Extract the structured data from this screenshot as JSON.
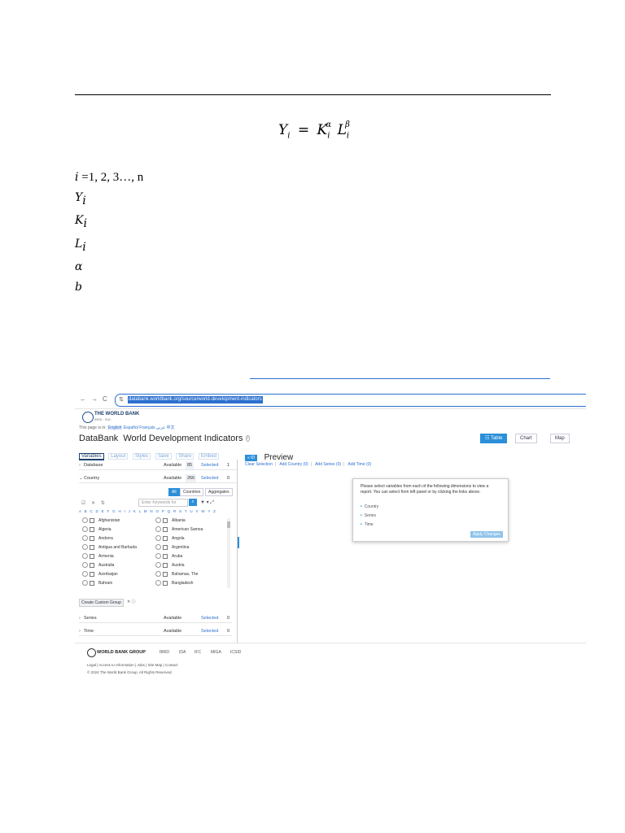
{
  "document": {
    "formula": {
      "Y": "Y",
      "K": "K",
      "L": "L",
      "sub": "i",
      "eq": "=",
      "alpha": "α",
      "beta": "β"
    },
    "index_line": {
      "var": "i",
      "text": " =1, 2, 3…, n"
    },
    "variables": [
      {
        "sym": "Y",
        "sub": "i"
      },
      {
        "sym": "K",
        "sub": "i"
      },
      {
        "sym": "L",
        "sub": "i"
      },
      {
        "sym": "α",
        "sub": ""
      },
      {
        "sym": "b",
        "sub": ""
      }
    ]
  },
  "screenshot": {
    "browser": {
      "back": "←",
      "forward": "→",
      "reload": "C",
      "url": "databank.worldbank.org/source/world-development-indicators"
    },
    "header": {
      "org_name": "THE WORLD BANK",
      "org_sub": "IBRD · IDA",
      "lang_prefix": "This page is in:",
      "lang_current": "English",
      "lang_others": "Español  Français  عربي  中文",
      "brand": "DataBank",
      "database_title": "World Development Indicators",
      "info": "i"
    },
    "view_buttons": {
      "table": "☷ Table",
      "chart": "Chart",
      "map": "Map"
    },
    "tabs": [
      "Variables",
      "Layout",
      "Styles",
      "Save",
      "Share",
      "Embed"
    ],
    "panels": {
      "database": {
        "label": "Database",
        "available": "Available",
        "available_count": "85",
        "selected": "Selected",
        "selected_count": "1"
      },
      "country": {
        "label": "Country",
        "available": "Available",
        "available_count": "266",
        "selected": "Selected",
        "selected_count": "0"
      },
      "series": {
        "label": "Series",
        "available": "Available",
        "selected": "Selected",
        "selected_count": "0"
      },
      "time": {
        "label": "Time",
        "available": "Available",
        "selected": "Selected",
        "selected_count": "0"
      }
    },
    "country_filter": {
      "all": "All",
      "countries": "Countries",
      "aggregates": "Aggregates",
      "keyword_placeholder": "Enter Keywords for",
      "letters": "A B C D E F G H I J K L M N O P Q R S T U V W Y Z"
    },
    "countries_col1": [
      "Afghanistan",
      "Algeria",
      "Andorra",
      "Antigua and Barbuda",
      "Armenia",
      "Australia",
      "Azerbaijan",
      "Bahrain"
    ],
    "countries_col2": [
      "Albania",
      "American Samoa",
      "Angola",
      "Argentina",
      "Aruba",
      "Austria",
      "Bahamas, The",
      "Bangladesh"
    ],
    "create_group": "Create Custom Group",
    "preview": {
      "toggle": "« ID",
      "title": "Preview",
      "links": [
        "Clear Selection",
        "Add Country (0)",
        "Add Series (0)",
        "Add Time (0)"
      ]
    },
    "modal": {
      "message": "Please select variables from each of the following dimensions to view a report. You can select from left panel or by clicking the links above.",
      "items": [
        "Country",
        "Series",
        "Time"
      ],
      "apply": "Apply Changes"
    },
    "footer": {
      "logo": "WORLD BANK GROUP",
      "orgs": [
        "IBRD",
        "IDA",
        "IFC",
        "MIGA",
        "ICSID"
      ],
      "links": "Legal   |   Access to Information   |   Jobs   |   Site Map   |   Contact",
      "copyright": "© 2024 The World Bank Group, All Rights Reserved."
    }
  }
}
